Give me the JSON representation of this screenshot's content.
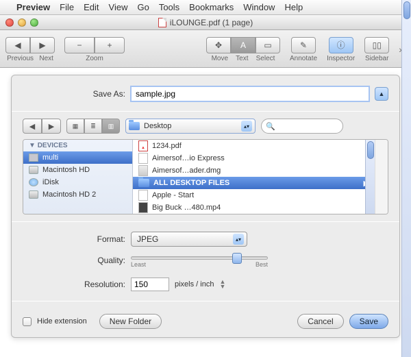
{
  "menubar": {
    "apple": "",
    "app": "Preview",
    "items": [
      "File",
      "Edit",
      "View",
      "Go",
      "Tools",
      "Bookmarks",
      "Window",
      "Help"
    ]
  },
  "window": {
    "title": "iLOUNGE.pdf (1 page)"
  },
  "toolbar": {
    "prev": "Previous",
    "next": "Next",
    "zoom": "Zoom",
    "move": "Move",
    "text": "Text",
    "select": "Select",
    "annotate": "Annotate",
    "inspector": "Inspector",
    "sidebar": "Sidebar"
  },
  "save": {
    "save_as_label": "Save As:",
    "filename": "sample.jpg",
    "location": "Desktop",
    "search_placeholder": "",
    "sidebar_header": "DEVICES",
    "devices": [
      {
        "name": "multi",
        "icon": "display"
      },
      {
        "name": "Macintosh HD",
        "icon": "hd"
      },
      {
        "name": "iDisk",
        "icon": "idisk"
      },
      {
        "name": "Macintosh HD 2",
        "icon": "hd"
      }
    ],
    "files": [
      {
        "name": "1234.pdf",
        "icon": "pdf"
      },
      {
        "name": "Aimersof…io Express",
        "icon": "doc"
      },
      {
        "name": "Aimersof…ader.dmg",
        "icon": "dmg"
      },
      {
        "name": "ALL DESKTOP FILES",
        "icon": "folder",
        "selected": true,
        "has_children": true
      },
      {
        "name": "Apple - Start",
        "icon": "doc"
      },
      {
        "name": "Big Buck …480.mp4",
        "icon": "mp4"
      }
    ],
    "format_label": "Format:",
    "format_value": "JPEG",
    "quality_label": "Quality:",
    "quality_least": "Least",
    "quality_best": "Best",
    "quality_pos": 0.74,
    "resolution_label": "Resolution:",
    "resolution_value": "150",
    "resolution_units": "pixels / inch",
    "hide_ext": "Hide extension",
    "new_folder": "New Folder",
    "cancel": "Cancel",
    "save_btn": "Save"
  }
}
